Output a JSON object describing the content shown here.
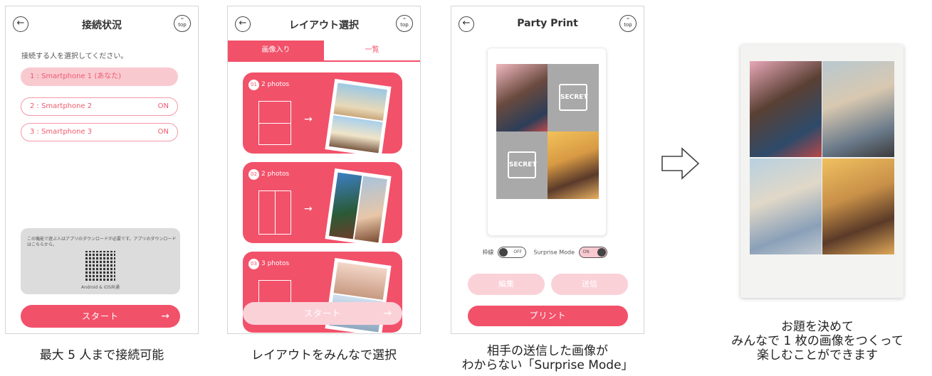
{
  "icons": {
    "back": "arrow-left-icon",
    "top": "top-icon",
    "arrow": "arrow-right-icon",
    "secret": "secret-icon"
  },
  "colors": {
    "accent": "#f2516a",
    "accent_light": "#fbd1d8",
    "panel_gray": "#dcdcdc"
  },
  "phone1": {
    "title": "接続状況",
    "top_label": "top",
    "instruction": "接続する人を選択してください。",
    "devices": [
      {
        "label": "1 : Smartphone 1 (あなた)",
        "status": ""
      },
      {
        "label": "2 : Smartphone 2",
        "status": "ON"
      },
      {
        "label": "3 : Smartphone 3",
        "status": "ON"
      }
    ],
    "download_text": "この機能で遊ぶ人はアプリのダウンロードが必要です。アプリのダウンロードはこちらから。",
    "download_caption": "Android & iOS共通",
    "start_label": "スタート"
  },
  "phone2": {
    "title": "レイアウト選択",
    "top_label": "top",
    "tabs": [
      "画像入り",
      "一覧"
    ],
    "layouts": [
      {
        "num": "01",
        "label": "2 photos"
      },
      {
        "num": "02",
        "label": "2 photos"
      },
      {
        "num": "03",
        "label": "3 photos"
      }
    ],
    "start_label": "スタート"
  },
  "phone3": {
    "title": "Party Print",
    "top_label": "top",
    "secret_label": "SECRET",
    "toggle1_label": "枠線",
    "toggle1_state": "OFF",
    "toggle2_label": "Surprise Mode",
    "toggle2_state": "ON",
    "edit_label": "編集",
    "send_label": "送信",
    "print_label": "プリント"
  },
  "captions": {
    "c1": "最大 5 人まで接続可能",
    "c2": "レイアウトをみんなで選択",
    "c3_line1": "相手の送信した画像が",
    "c3_line2": "わからない「Surprise Mode」",
    "c4_line1": "お題を決めて",
    "c4_line2": "みんなで 1 枚の画像をつくって",
    "c4_line3": "楽しむことができます"
  }
}
